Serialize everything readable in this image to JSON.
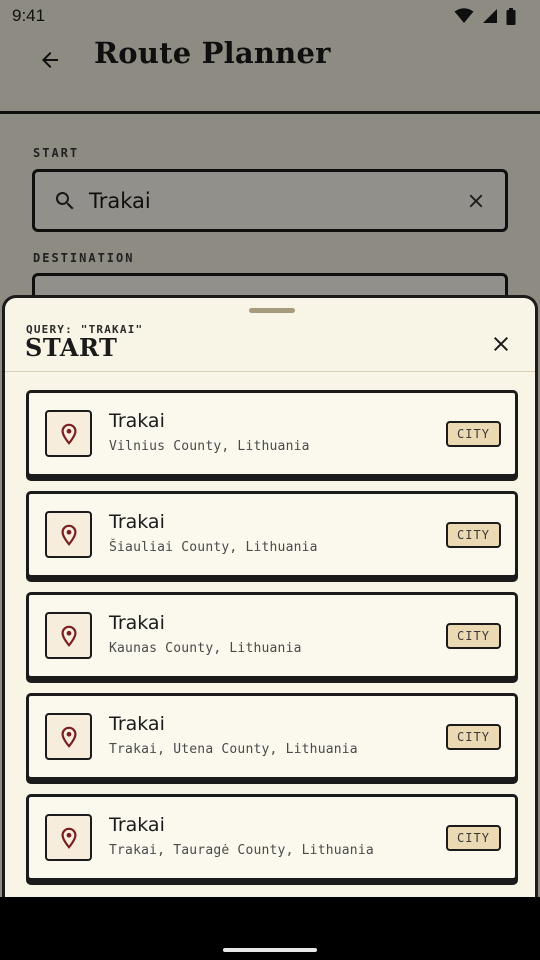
{
  "status_bar": {
    "time": "9:41"
  },
  "app_bar": {
    "title": "Route Planner"
  },
  "form": {
    "start_label": "START",
    "start_value": "Trakai",
    "destination_label": "DESTINATION"
  },
  "sheet": {
    "query_label": "QUERY: \"TRAKAI\"",
    "title": "START",
    "results": [
      {
        "title": "Trakai",
        "subtitle": "Vilnius County, Lithuania",
        "badge": "CITY"
      },
      {
        "title": "Trakai",
        "subtitle": "Šiauliai County, Lithuania",
        "badge": "CITY"
      },
      {
        "title": "Trakai",
        "subtitle": "Kaunas County, Lithuania",
        "badge": "CITY"
      },
      {
        "title": "Trakai",
        "subtitle": "Trakai, Utena County, Lithuania",
        "badge": "CITY"
      },
      {
        "title": "Trakai",
        "subtitle": "Trakai, Tauragė County, Lithuania",
        "badge": "CITY"
      }
    ]
  },
  "icons": {
    "back": "arrow-back-icon",
    "search": "search-icon",
    "clear": "clear-icon",
    "close": "close-icon",
    "pin": "location-pin-icon"
  },
  "colors": {
    "background": "#f5f0e1",
    "ink": "#1b1b1b",
    "pin": "#7a1f1f",
    "badge": "#ead9b3"
  }
}
